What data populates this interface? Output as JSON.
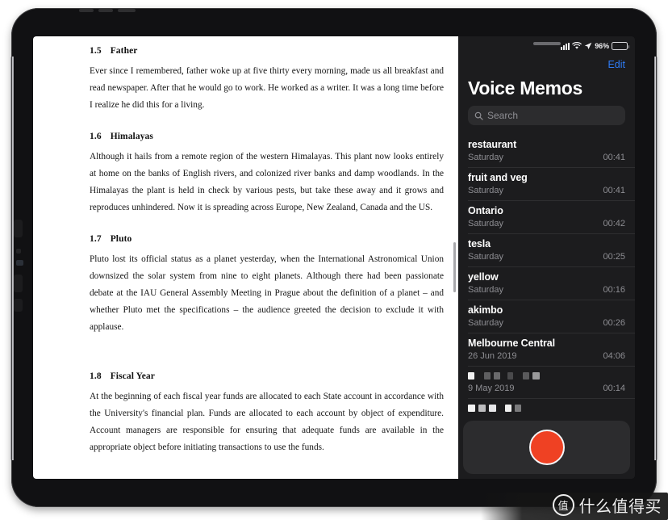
{
  "device": {
    "type": "tablet-frame"
  },
  "document": {
    "sections": [
      {
        "number": "1.5",
        "title": "Father",
        "body": "Ever since I remembered, father woke up at five thirty every morning, made us all breakfast and read newspaper. After that he would go to work. He worked as a writer. It was a long time before I realize he did this for a living."
      },
      {
        "number": "1.6",
        "title": "Himalayas",
        "body": "Although it hails from a remote region of the western Himalayas. This plant now looks entirely at home on the banks of English rivers, and colonized river banks and damp woodlands. In the Himalayas the plant is held in check by various pests, but take these away and it grows and reproduces unhindered. Now it is spreading across Europe, New Zealand, Canada and the US."
      },
      {
        "number": "1.7",
        "title": "Pluto",
        "body": "Pluto lost its official status as a planet yesterday, when the International Astronomical Union downsized the solar system from nine to eight planets. Although there had been passionate debate at the IAU General Assembly Meeting in Prague about the definition of a planet – and whether Pluto met the specifications – the audience greeted the decision to exclude it with applause."
      },
      {
        "number": "1.8",
        "title": "Fiscal Year",
        "body": "At the beginning of each fiscal year funds are allocated to each State account in accordance with the University's financial plan. Funds are allocated to each account by object of expenditure. Account managers are responsible for ensuring that adequate funds are available in the appropriate object before initiating transactions to use the funds."
      }
    ]
  },
  "memos": {
    "status_bar": {
      "battery_percent": "96%",
      "icons": [
        "cellular-signal-icon",
        "wifi-icon",
        "location-arrow-icon",
        "battery-icon"
      ]
    },
    "edit_label": "Edit",
    "title": "Voice Memos",
    "search": {
      "placeholder": "Search",
      "icon": "search-icon"
    },
    "items": [
      {
        "title": "restaurant",
        "redacted": false,
        "date": "Saturday",
        "duration": "00:41"
      },
      {
        "title": "fruit and veg",
        "redacted": false,
        "date": "Saturday",
        "duration": "00:41"
      },
      {
        "title": "Ontario",
        "redacted": false,
        "date": "Saturday",
        "duration": "00:42"
      },
      {
        "title": "tesla",
        "redacted": false,
        "date": "Saturday",
        "duration": "00:25"
      },
      {
        "title": "yellow",
        "redacted": false,
        "date": "Saturday",
        "duration": "00:16"
      },
      {
        "title": "akimbo",
        "redacted": false,
        "date": "Saturday",
        "duration": "00:26"
      },
      {
        "title": "Melbourne Central",
        "redacted": false,
        "date": "26 Jun 2019",
        "duration": "04:06"
      },
      {
        "title": "",
        "redacted": true,
        "date": "9 May 2019",
        "duration": "00:14"
      },
      {
        "title": "",
        "redacted": true,
        "date": "",
        "duration": ""
      }
    ],
    "record_button": {
      "name": "record-button",
      "color": "#ef4123"
    }
  },
  "watermark": {
    "logo_char": "值",
    "text": "什么值得买"
  },
  "colors": {
    "accent_blue": "#2f7cf6",
    "panel_bg": "#1c1c1e",
    "field_bg": "#2c2c2e",
    "record_red": "#ef4123",
    "secondary_text": "#8e8e93"
  }
}
